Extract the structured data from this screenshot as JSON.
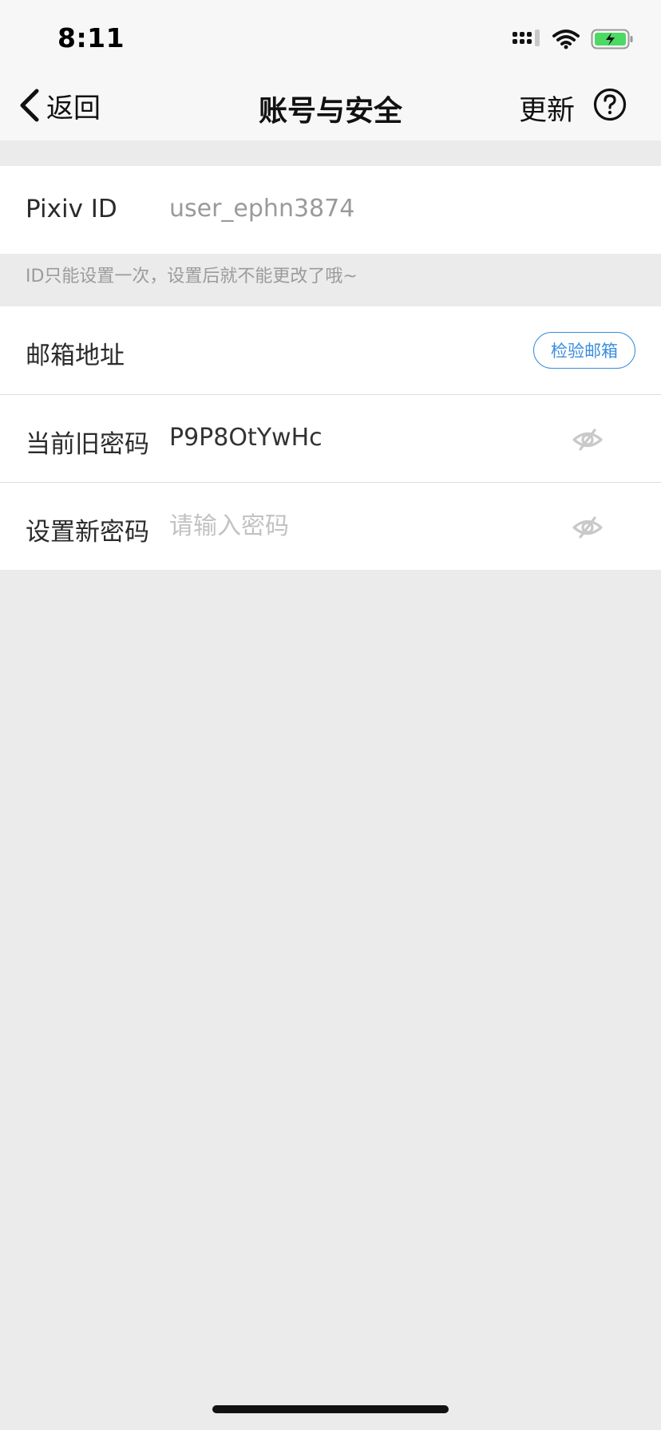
{
  "status_bar": {
    "time": "8:11"
  },
  "nav": {
    "back_label": "返回",
    "title": "账号与安全",
    "update_label": "更新"
  },
  "pixiv_id": {
    "label": "Pixiv ID",
    "value": "user_ephn3874",
    "hint": "ID只能设置一次，设置后就不能更改了哦~"
  },
  "email": {
    "label": "邮箱地址",
    "verify_label": "检验邮箱"
  },
  "current_password": {
    "label": "当前旧密码",
    "value": "P9P8OtYwHc"
  },
  "new_password": {
    "label": "设置新密码",
    "placeholder": "请输入密码"
  },
  "colors": {
    "accent": "#3a8dde",
    "background": "#ebebeb",
    "battery_fill": "#4cd964"
  }
}
